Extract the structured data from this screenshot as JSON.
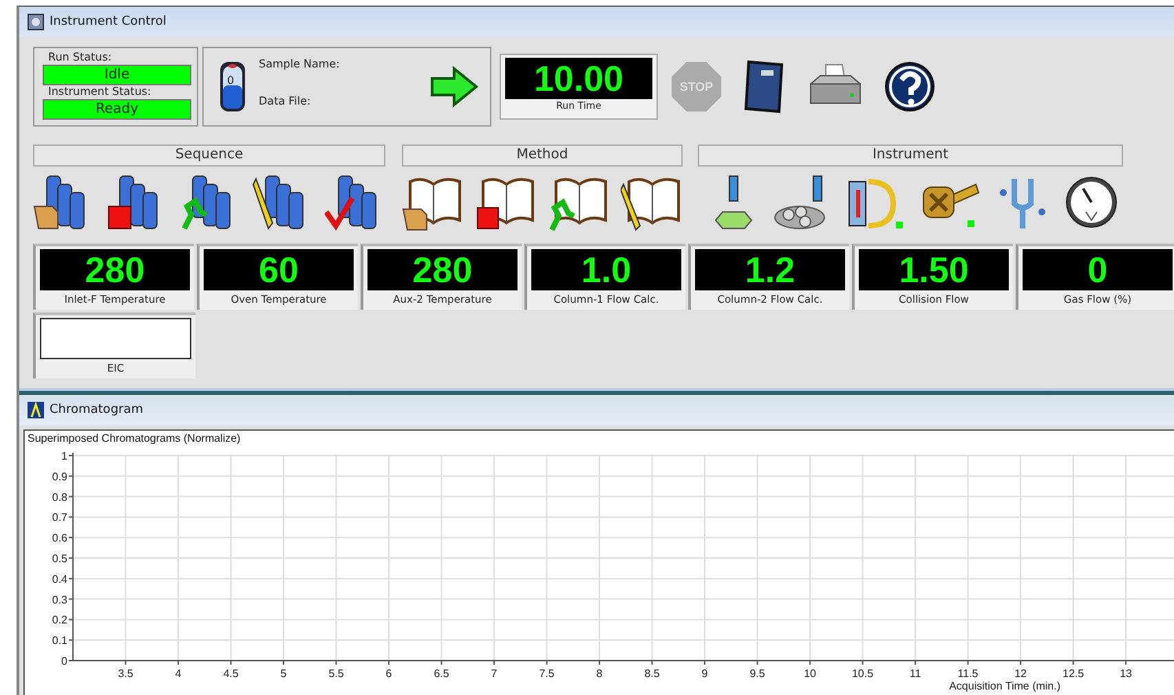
{
  "window": {
    "title": "Instrument Control"
  },
  "status": {
    "run_label": "Run Status:",
    "run_value": "Idle",
    "instrument_label": "Instrument Status:",
    "instrument_value": "Ready"
  },
  "sample": {
    "vial_number": "0",
    "name_label": "Sample Name:",
    "file_label": "Data File:"
  },
  "run_time": {
    "value": "10.00",
    "label": "Run Time"
  },
  "stop_button": {
    "label": "STOP"
  },
  "sections": [
    {
      "title": "Sequence"
    },
    {
      "title": "Method"
    },
    {
      "title": "Instrument"
    }
  ],
  "gauges": [
    {
      "value": "280",
      "label": "Inlet-F Temperature"
    },
    {
      "value": "60",
      "label": "Oven Temperature"
    },
    {
      "value": "280",
      "label": "Aux-2 Temperature"
    },
    {
      "value": "1.0",
      "label": "Column-1 Flow Calc."
    },
    {
      "value": "1.2",
      "label": "Column-2 Flow Calc."
    },
    {
      "value": "1.50",
      "label": "Collision Flow"
    },
    {
      "value": "0",
      "label": "Gas Flow (%)"
    }
  ],
  "eic": {
    "label": "EIC"
  },
  "chromatogram": {
    "title": "Chromatogram",
    "chart_data": {
      "type": "line",
      "grid": true,
      "title": "Superimposed Chromatograms (Normalize)",
      "xlabel": "Acquisition Time (min.)",
      "xlim": [
        3,
        13.47
      ],
      "ylim": [
        0,
        1
      ],
      "xticks": [
        3.5,
        4,
        4.5,
        5,
        5.5,
        6,
        6.5,
        7,
        7.5,
        8,
        8.5,
        9,
        9.5,
        10,
        10.5,
        11,
        11.5,
        12,
        12.5,
        13
      ],
      "yticks": [
        0,
        0.1,
        0.2,
        0.3,
        0.4,
        0.5,
        0.6,
        0.7,
        0.8,
        0.9,
        1
      ]
    }
  }
}
